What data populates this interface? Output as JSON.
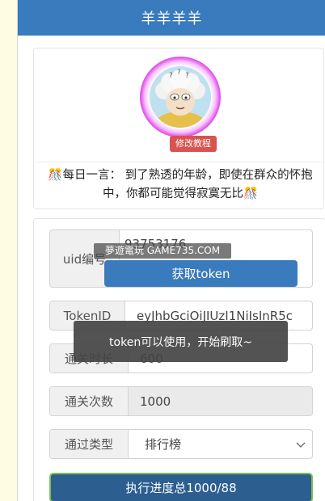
{
  "header": {
    "title": "羊羊羊羊"
  },
  "profile": {
    "avatar_icon": "sheep-avatar-icon",
    "badge_label": "修改教程",
    "quote_prefix": "每日一言：",
    "quote_text": "到了熟透的年龄，即使在群众的怀抱中，你都可能觉得寂寞无比",
    "quote_icon": "confetti-icon"
  },
  "form": {
    "uid": {
      "label": "uid编号",
      "value": "93753176"
    },
    "get_token_button": "获取token",
    "token": {
      "label": "TokenID",
      "value": "eyJhbGciOiJIUzI1NiIsInR5c"
    },
    "duration": {
      "label": "通关时长",
      "value": "600"
    },
    "count": {
      "label": "通关次数",
      "value": "1000"
    },
    "type": {
      "label": "通过类型",
      "selected": "排行榜"
    },
    "progress_button": "执行进度总1000/88"
  },
  "watermark": "夢遊電玩 GAME735.COM",
  "toast": "token可以使用，开始刷取~",
  "colors": {
    "primary": "#3a7bbd",
    "danger": "#d9534f",
    "page_bg": "#fefde4"
  }
}
